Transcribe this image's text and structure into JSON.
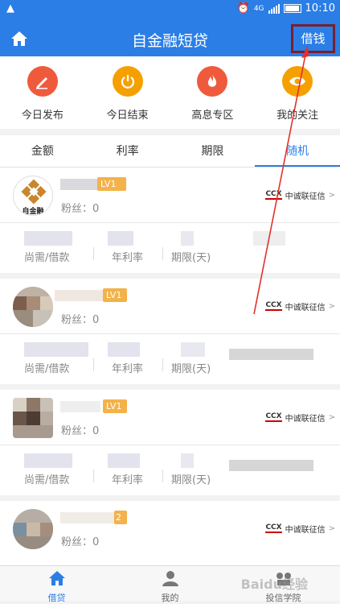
{
  "status": {
    "time": "10:10",
    "network": "4G"
  },
  "header": {
    "title": "自金融短贷",
    "action": "借钱"
  },
  "quick": [
    {
      "label": "今日发布",
      "color": "#ef5a3d",
      "icon": "pencil-icon"
    },
    {
      "label": "今日结束",
      "color": "#f5a000",
      "icon": "power-icon"
    },
    {
      "label": "高息专区",
      "color": "#ef5a3d",
      "icon": "flame-icon"
    },
    {
      "label": "我的关注",
      "color": "#f5a000",
      "icon": "eye-icon"
    }
  ],
  "tabs": [
    "金额",
    "利率",
    "期限",
    "随机"
  ],
  "cards": [
    {
      "level": "LV1",
      "fans": "粉丝：0",
      "credit": "中诚联征信",
      "labels": [
        "尚需/借款",
        "年利率",
        "期限(天)"
      ],
      "avatar_text": "自金融"
    },
    {
      "level": "LV1",
      "fans": "粉丝：0",
      "credit": "中诚联征信",
      "labels": [
        "尚需/借款",
        "年利率",
        "期限(天)"
      ]
    },
    {
      "level": "LV1",
      "fans": "粉丝：0",
      "credit": "中诚联征信",
      "labels": [
        "尚需/借款",
        "年利率",
        "期限(天)"
      ]
    },
    {
      "level": "2",
      "fans": "粉丝：0",
      "credit": "中诚联征信"
    }
  ],
  "credit_logo": "CCX",
  "nav": [
    {
      "label": "借贷",
      "icon": "home-icon"
    },
    {
      "label": "我的",
      "icon": "user-icon"
    },
    {
      "label": "投信学院",
      "icon": "academy-icon"
    }
  ],
  "watermark": "Baidu经验"
}
